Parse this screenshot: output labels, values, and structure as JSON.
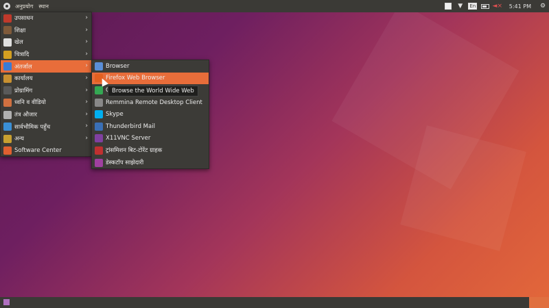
{
  "top_panel": {
    "menu_label": "अनुप्रयोग",
    "places_label": "स्थान",
    "keyboard_label": "En",
    "clock": "5:41 PM",
    "icons": [
      "notes-icon",
      "wifi-icon",
      "keyboard-layout-icon",
      "battery-icon",
      "volume-muted-icon",
      "gear-icon"
    ]
  },
  "applications_menu": {
    "items": [
      {
        "label": "उपसाधन",
        "icon": "accessories-icon",
        "color": "#c0392b"
      },
      {
        "label": "शिक्षा",
        "icon": "education-icon",
        "color": "#7f5a3a"
      },
      {
        "label": "खेल",
        "icon": "games-icon",
        "color": "#e0e0e0"
      },
      {
        "label": "चित्रादि",
        "icon": "graphics-icon",
        "color": "#d4a020"
      },
      {
        "label": "अंतर्जाल",
        "icon": "internet-icon",
        "color": "#3a7bd5",
        "active": true
      },
      {
        "label": "कार्यालय",
        "icon": "office-icon",
        "color": "#c89030"
      },
      {
        "label": "प्रोग्रामिंग",
        "icon": "programming-icon",
        "color": "#5a5a5a"
      },
      {
        "label": "ध्वनि व वीडियो",
        "icon": "sound-video-icon",
        "color": "#d07040"
      },
      {
        "label": "तंत्र औजार",
        "icon": "system-tools-icon",
        "color": "#b0b0b0"
      },
      {
        "label": "सार्वभौमिक पहुँच",
        "icon": "universal-access-icon",
        "color": "#3a8fd5"
      },
      {
        "label": "अन्य",
        "icon": "other-icon",
        "color": "#c8a030"
      },
      {
        "label": "Software Center",
        "icon": "software-center-icon",
        "color": "#e06030",
        "no_arrow": true
      }
    ]
  },
  "internet_submenu": {
    "items": [
      {
        "label": "Browser",
        "icon": "browser-icon",
        "color": "#5a8fd8"
      },
      {
        "label": "Firefox Web Browser",
        "icon": "firefox-icon",
        "color": "#e46020",
        "active": true
      },
      {
        "label": "G",
        "icon": "chrome-icon",
        "color": "#34a853"
      },
      {
        "label": "Remmina Remote Desktop Client",
        "icon": "remmina-icon",
        "color": "#888888"
      },
      {
        "label": "Skype",
        "icon": "skype-icon",
        "color": "#00aff0"
      },
      {
        "label": "Thunderbird Mail",
        "icon": "thunderbird-icon",
        "color": "#3a6fb5"
      },
      {
        "label": "X11VNC Server",
        "icon": "vnc-icon",
        "color": "#8040a0"
      },
      {
        "label": "ट्रांसमिशन बिट-टोरेंट ग्राहक",
        "icon": "transmission-icon",
        "color": "#c03030"
      },
      {
        "label": "डेस्कटॉप साझेदारी",
        "icon": "desktop-sharing-icon",
        "color": "#a040a0"
      }
    ]
  },
  "tooltip": "Browse the World Wide Web",
  "colors": {
    "panel": "#3b3a36",
    "menu": "#3c3b37",
    "accent": "#e86d3a"
  }
}
